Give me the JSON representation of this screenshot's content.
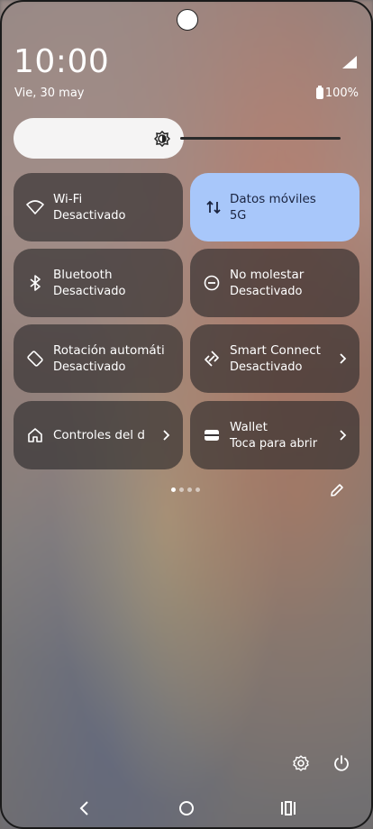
{
  "status": {
    "time": "10:00",
    "date": "Vie, 30 may",
    "battery": "100%"
  },
  "brightness": {
    "level": 0.47
  },
  "tiles": [
    {
      "title": "Wi-Fi",
      "subtitle": "Desactivado",
      "icon": "wifi-icon"
    },
    {
      "title": "Datos móviles",
      "subtitle": "5G",
      "icon": "mobile-data-icon",
      "active": true
    },
    {
      "title": "Bluetooth",
      "subtitle": "Desactivado",
      "icon": "bluetooth-icon"
    },
    {
      "title": "No molestar",
      "subtitle": "Desactivado",
      "icon": "do-not-disturb-icon"
    },
    {
      "title": "Rotación automática",
      "subtitle": "Desactivado",
      "icon": "auto-rotate-icon"
    },
    {
      "title": "Smart Connect",
      "subtitle": "Desactivado",
      "icon": "smart-connect-icon"
    },
    {
      "title": "Controles del dispositivo",
      "subtitle": "",
      "icon": "home-icon"
    },
    {
      "title": "Wallet",
      "subtitle": "Toca para abrir",
      "icon": "wallet-icon"
    }
  ],
  "colors": {
    "active_tile": "#a8c7fa",
    "tile_bg": "#2a282a"
  },
  "pagination": {
    "pages": 4,
    "current": 1
  }
}
